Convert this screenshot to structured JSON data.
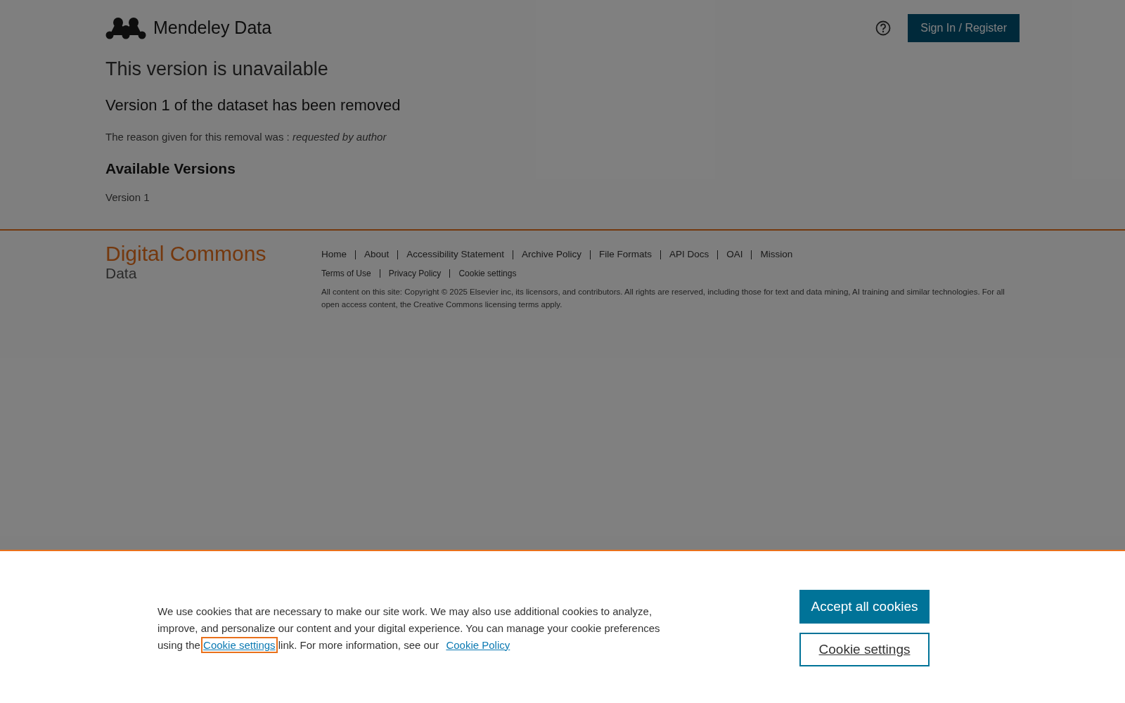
{
  "header": {
    "logo_text": "Mendeley Data",
    "sign_in": "Sign In / Register"
  },
  "main": {
    "title": "This version is unavailable",
    "subtitle": "Version 1 of the dataset has been removed",
    "reason_label": "The reason given for this removal was : ",
    "reason": "requested by author",
    "versions_heading": "Available Versions",
    "versions": [
      "Version 1"
    ]
  },
  "footer": {
    "logo_title": "Digital Commons",
    "logo_sub": "Data",
    "links": [
      "Home",
      "About",
      "Accessibility Statement",
      "Archive Policy",
      "File Formats",
      "API Docs",
      "OAI",
      "Mission"
    ],
    "links_secondary": [
      "Terms of Use",
      "Privacy Policy",
      "Cookie settings"
    ],
    "copyright": "All content on this site: Copyright © 2025 Elsevier inc, its licensors, and contributors. All rights are reserved, including those for text and data mining, AI training and similar technologies. For all open access content, the Creative Commons licensing terms apply."
  },
  "cookie_banner": {
    "text_before": "We use cookies that are necessary to make our site work. We may also use additional cookies to analyze, improve, and personalize our content and your digital experience. You can manage your cookie preferences using the ",
    "settings_link": "Cookie settings",
    "text_middle": "link. For more information, see our ",
    "policy_link": "Cookie Policy",
    "accept": "Accept all cookies",
    "settings_button": "Cookie settings"
  }
}
